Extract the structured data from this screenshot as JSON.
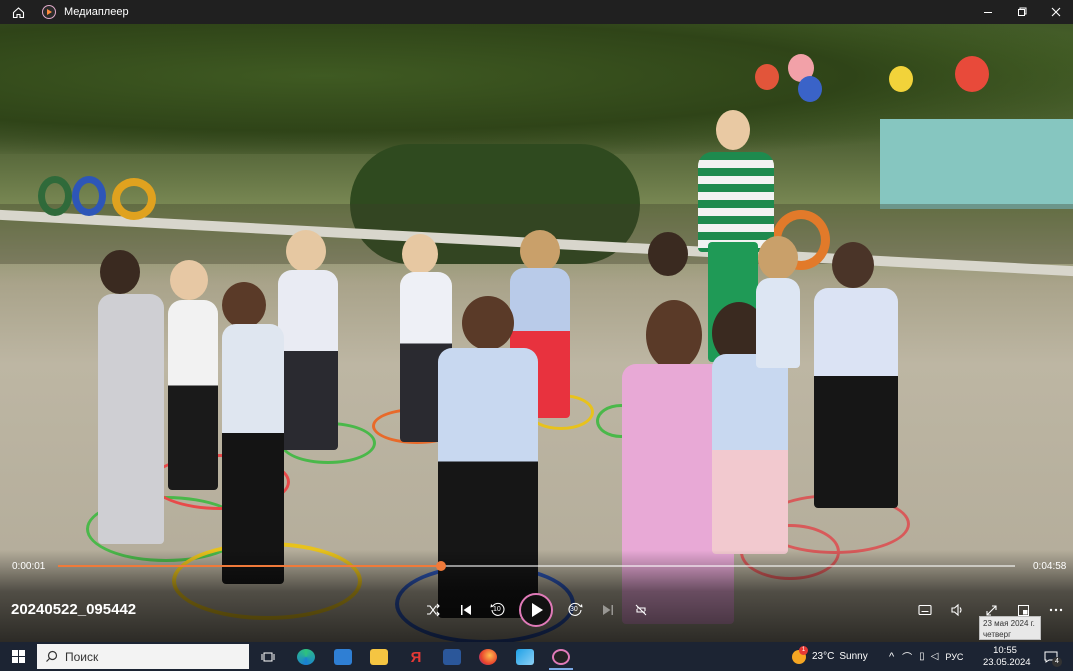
{
  "titlebar": {
    "app_title": "Медиаплеер",
    "icons": [
      "home-icon",
      "media-player-icon"
    ],
    "window_controls": [
      "minimize-icon",
      "maximize-icon",
      "close-icon"
    ]
  },
  "player": {
    "video_title": "20240522_095442",
    "current_time": "0:00:01",
    "total_time": "0:04:58",
    "progress_fraction": 0.4,
    "accent_color": "#f07a3a",
    "controls": {
      "shuffle": "shuffle-icon",
      "previous": "previous-icon",
      "rewind_label": "10",
      "play": "play-icon",
      "forward_label": "30",
      "next": "next-icon",
      "repeat": "repeat-off-icon",
      "subtitles": "subtitles-icon",
      "volume": "volume-icon",
      "fullscreen": "fullscreen-icon",
      "miniplayer": "miniplayer-icon",
      "more": "more-icon"
    },
    "tooltip": {
      "line1": "23 мая 2024 г.",
      "line2": "четверг"
    }
  },
  "taskbar": {
    "search_placeholder": "Поиск",
    "apps": [
      "task-view-icon",
      "edge-icon",
      "mail-icon",
      "file-explorer-icon",
      "yandex-browser-icon",
      "word-icon",
      "firefox-icon",
      "photos-icon",
      "media-player-icon"
    ],
    "weather_temp": "23°C",
    "weather_text": "Sunny",
    "weather_badge": "1",
    "language": "РУС",
    "time": "10:55",
    "date": "23.05.2024",
    "notifications_count": "4"
  }
}
